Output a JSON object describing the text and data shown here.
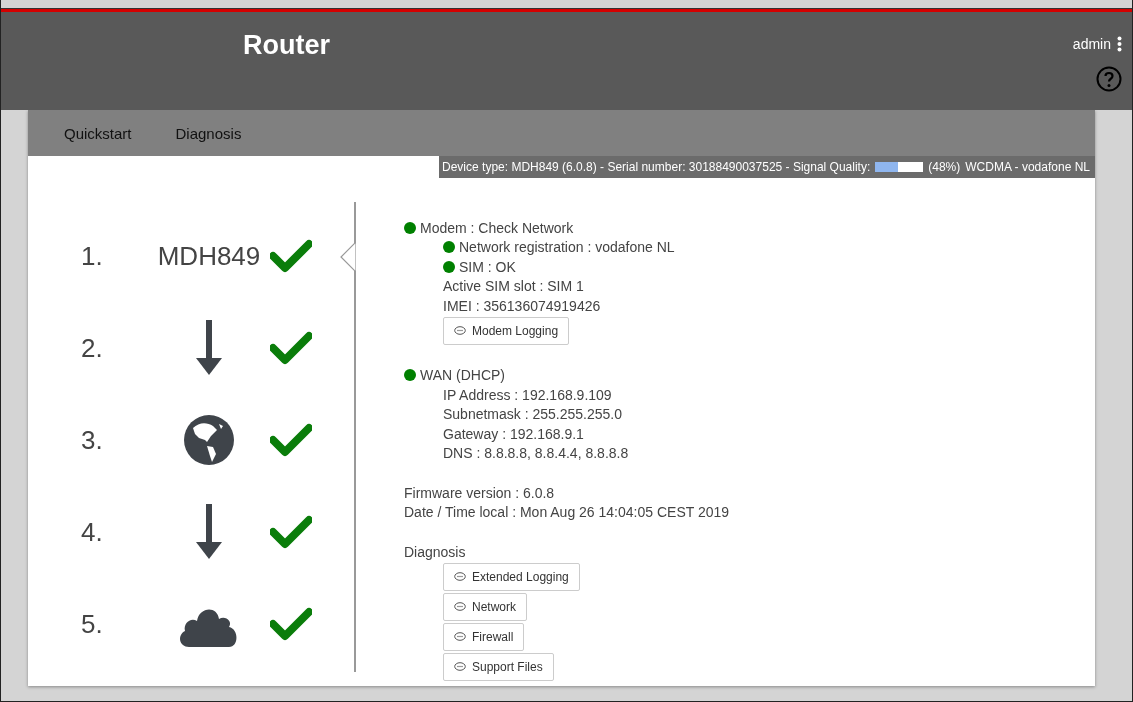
{
  "header": {
    "title": "Router",
    "user": "admin"
  },
  "nav": [
    {
      "label": "Quickstart",
      "selected": false
    },
    {
      "label": "Diagnosis",
      "selected": false
    }
  ],
  "info_bar": {
    "device": "Device type: MDH849 (6.0.8) - Serial number: 30188490037525  - Signal Quality:",
    "signal": {
      "level": 0.48
    },
    "reading": "(48%)",
    "network": "WCDMA - vodafone NL"
  },
  "steps": [
    {
      "number": "1.",
      "kind": "text",
      "label": "MDH849",
      "ok": true,
      "selected": true
    },
    {
      "number": "2.",
      "kind": "arrow",
      "ok": true,
      "selected": false
    },
    {
      "number": "3.",
      "kind": "globe",
      "ok": true,
      "selected": false
    },
    {
      "number": "4.",
      "kind": "arrow",
      "ok": true,
      "selected": false
    },
    {
      "number": "5.",
      "kind": "cloud",
      "ok": true,
      "selected": false
    }
  ],
  "sections": [
    [
      {
        "kind": "status",
        "label": "Modem : Check Network",
        "color": "#008000",
        "children": [
          {
            "kind": "status",
            "label": "Network registration : vodafone NL",
            "color": "#008000"
          },
          {
            "kind": "status",
            "label": "SIM : OK",
            "color": "#008000"
          },
          {
            "kind": "text",
            "label": "Active SIM slot : SIM 1"
          },
          {
            "kind": "text",
            "label": "IMEI : 356136074919426"
          },
          {
            "kind": "button",
            "label": "Modem Logging"
          }
        ]
      }
    ],
    [
      {
        "kind": "status",
        "label": "WAN (DHCP)",
        "color": "#008000",
        "children": [
          {
            "kind": "text",
            "label": "IP Address : 192.168.9.109"
          },
          {
            "kind": "text",
            "label": "Subnetmask : 255.255.255.0"
          },
          {
            "kind": "text",
            "label": "Gateway : 192.168.9.1"
          },
          {
            "kind": "text",
            "label": "DNS : 8.8.8.8, 8.8.4.4, 8.8.8.8"
          }
        ]
      }
    ],
    [
      {
        "kind": "text",
        "label": "Firmware version : 6.0.8"
      },
      {
        "kind": "text",
        "label": "Date / Time local : Mon Aug 26 14:04:05 CEST 2019"
      }
    ],
    [
      {
        "kind": "text",
        "label": "Diagnosis",
        "children": [
          {
            "kind": "button",
            "label": "Extended Logging"
          },
          {
            "kind": "button",
            "label": "Network"
          },
          {
            "kind": "button",
            "label": "Firewall"
          },
          {
            "kind": "button",
            "label": "Support Files"
          }
        ]
      }
    ]
  ]
}
